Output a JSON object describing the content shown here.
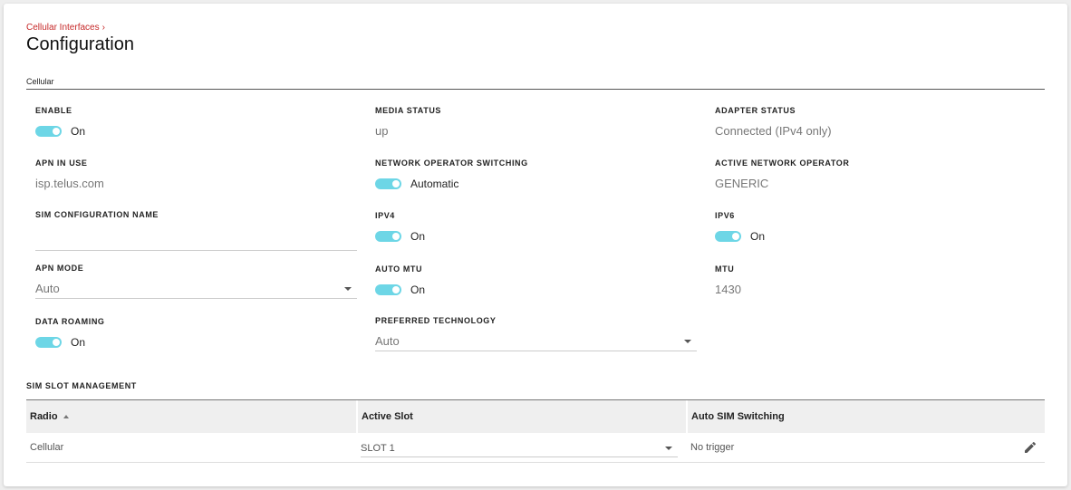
{
  "breadcrumb": {
    "parent": "Cellular Interfaces"
  },
  "page": {
    "title": "Configuration",
    "section": "Cellular"
  },
  "fields": {
    "enable": {
      "label": "ENABLE",
      "state": "On"
    },
    "media_status": {
      "label": "MEDIA STATUS",
      "value": "up"
    },
    "adapter_status": {
      "label": "ADAPTER STATUS",
      "value": "Connected (IPv4 only)"
    },
    "apn_in_use": {
      "label": "APN IN USE",
      "value": "isp.telus.com"
    },
    "network_operator_switching": {
      "label": "NETWORK OPERATOR SWITCHING",
      "state": "Automatic"
    },
    "active_network_operator": {
      "label": "ACTIVE NETWORK OPERATOR",
      "value": "GENERIC"
    },
    "sim_configuration_name": {
      "label": "SIM CONFIGURATION NAME",
      "value": ""
    },
    "ipv4": {
      "label": "IPV4",
      "state": "On"
    },
    "ipv6": {
      "label": "IPV6",
      "state": "On"
    },
    "apn_mode": {
      "label": "APN MODE",
      "value": "Auto"
    },
    "auto_mtu": {
      "label": "AUTO MTU",
      "state": "On"
    },
    "mtu": {
      "label": "MTU",
      "value": "1430"
    },
    "data_roaming": {
      "label": "DATA ROAMING",
      "state": "On"
    },
    "preferred_technology": {
      "label": "PREFERRED TECHNOLOGY",
      "value": "Auto"
    }
  },
  "sim_slot": {
    "title": "SIM SLOT MANAGEMENT",
    "columns": [
      "Radio",
      "Active Slot",
      "Auto SIM Switching"
    ],
    "rows": [
      {
        "radio": "Cellular",
        "active_slot": "SLOT 1",
        "auto_sim_switching": "No trigger"
      }
    ]
  },
  "colors": {
    "accent": "#6dd6e6",
    "breadcrumb": "#c62828"
  },
  "icons": [
    "chevron-right-icon",
    "dropdown-arrow-icon",
    "sort-ascending-icon",
    "edit-pencil-icon"
  ]
}
